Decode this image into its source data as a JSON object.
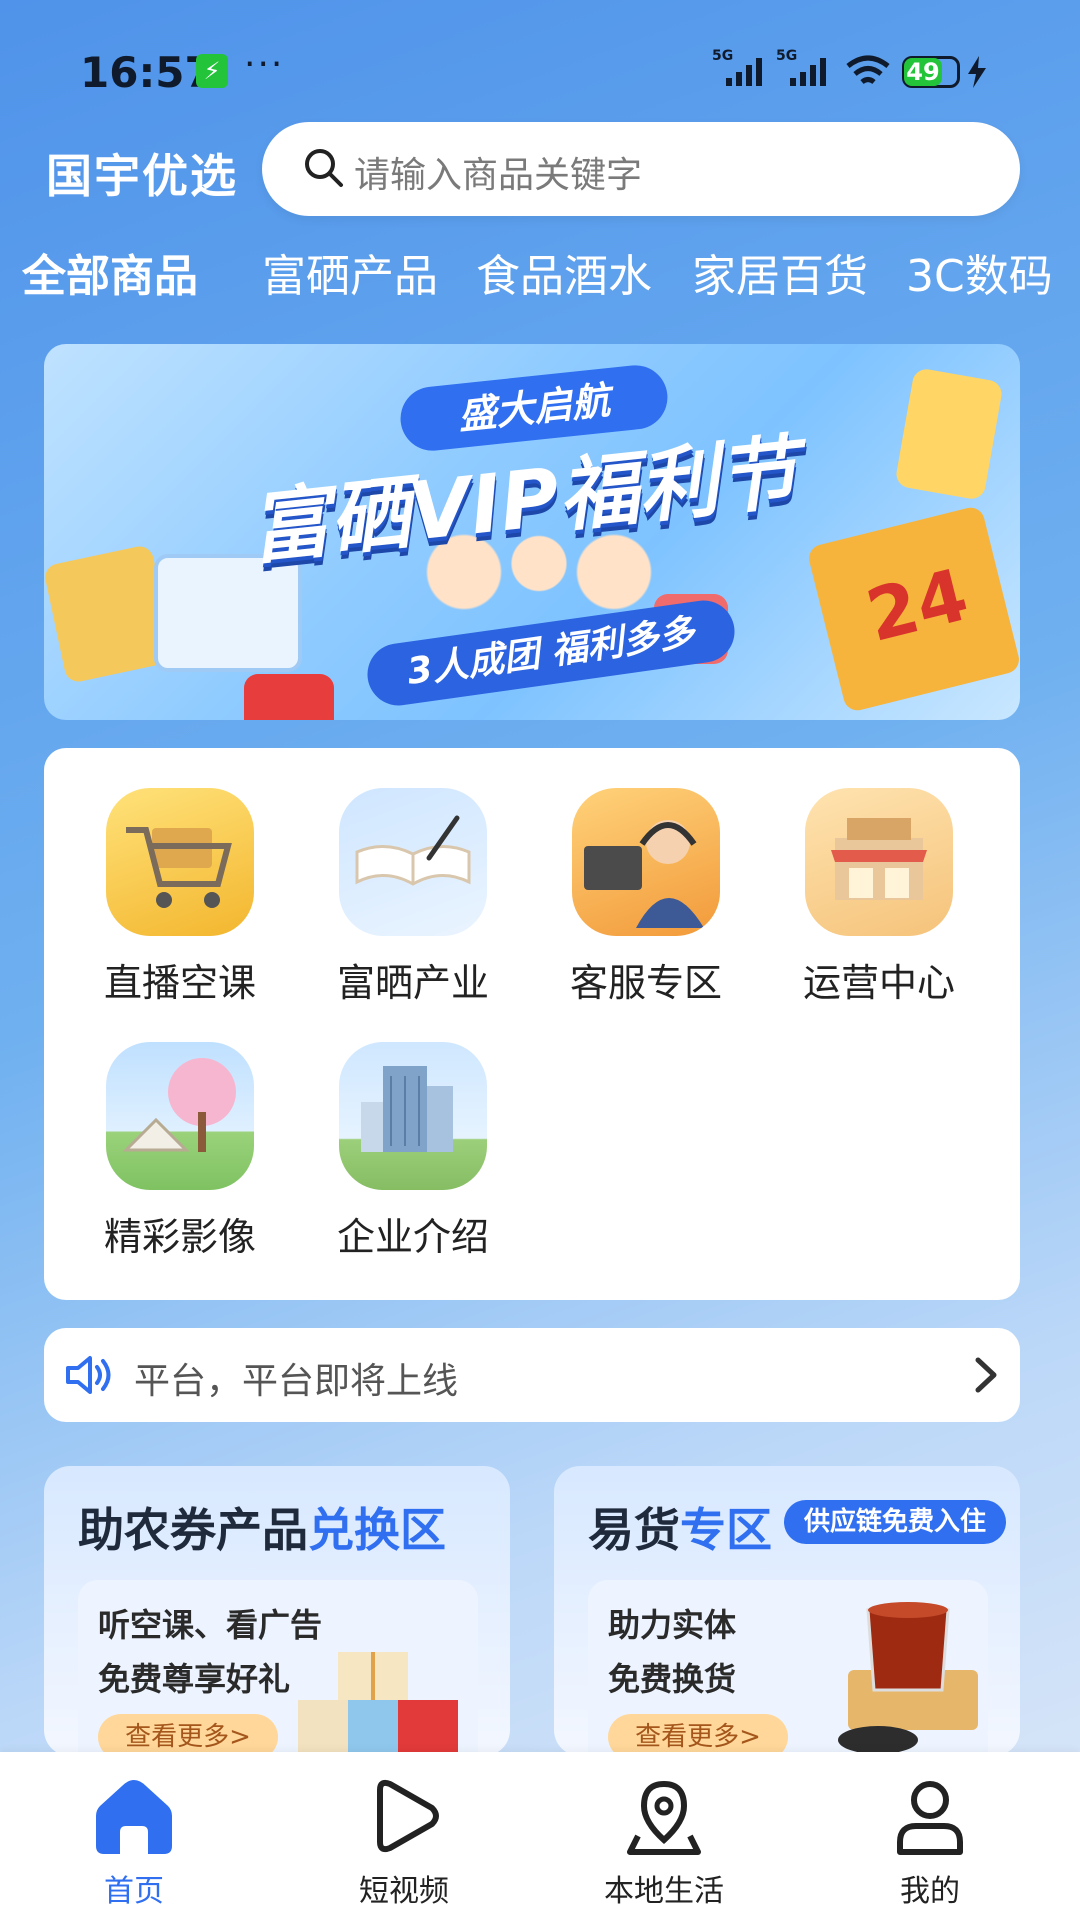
{
  "status_bar": {
    "time": "16:57",
    "charge_indicator": "⚡",
    "more": "···",
    "network_1": "5G",
    "network_2": "5G",
    "battery": "49"
  },
  "header": {
    "brand": "国宇优选",
    "search_placeholder": "请输入商品关键字"
  },
  "categories": [
    "全部商品",
    "富硒产品",
    "食品酒水",
    "家居百货",
    "3C数码"
  ],
  "banner": {
    "tag": "盛大启航",
    "title": "富硒VIP福利节",
    "subtitle": "3人成团 福利多多",
    "deco_number": "24"
  },
  "grid": [
    {
      "label": "直播空课",
      "icon": "shopping-cart-icon"
    },
    {
      "label": "富晒产业",
      "icon": "open-book-icon"
    },
    {
      "label": "客服专区",
      "icon": "customer-service-icon"
    },
    {
      "label": "运营中心",
      "icon": "store-icon"
    },
    {
      "label": "精彩影像",
      "icon": "scenery-icon"
    },
    {
      "label": "企业介绍",
      "icon": "building-icon"
    }
  ],
  "notice": {
    "text": "平台，平台即将上线"
  },
  "promo_left": {
    "title_a": "助农券产品",
    "title_b": "兑换区",
    "line1": "听空课、看广告",
    "line2": "免费尊享好礼",
    "more": "查看更多>"
  },
  "promo_right": {
    "title_a": "易货",
    "title_b": "专区",
    "badge": "供应链免费入住",
    "line1": "助力实体",
    "line2": "免费换货",
    "more": "查看更多>"
  },
  "nav": [
    {
      "label": "首页",
      "icon": "home-icon",
      "active": true
    },
    {
      "label": "短视频",
      "icon": "play-icon",
      "active": false
    },
    {
      "label": "本地生活",
      "icon": "location-pin-icon",
      "active": false
    },
    {
      "label": "我的",
      "icon": "user-icon",
      "active": false
    }
  ],
  "colors": {
    "accent": "#2f6ff0",
    "charge_green": "#23c43a"
  }
}
